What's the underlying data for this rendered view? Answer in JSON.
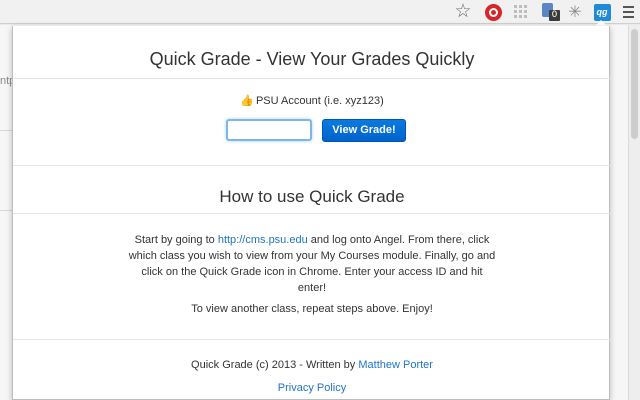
{
  "browser": {
    "icons": [
      "star-icon",
      "ublock-icon",
      "grid-icon",
      "extension-badge-icon",
      "bug-icon",
      "quick-grade-icon",
      "menu-icon"
    ],
    "extension_badge": "0",
    "quick_grade_icon_text": "qg"
  },
  "background_page": {
    "partial_text": "ntp"
  },
  "popup": {
    "title": "Quick Grade - View Your Grades Quickly",
    "account_label": "PSU Account (i.e. xyz123)",
    "input_value": "",
    "input_placeholder": "",
    "submit_label": "View Grade!",
    "howto_title": "How to use Quick Grade",
    "instructions_before_link": "Start by going to ",
    "instructions_link": "http://cms.psu.edu",
    "instructions_after_link": " and log onto Angel. From there, click which class you wish to view from your My Courses module. Finally, go and click on the Quick Grade icon in Chrome. Enter your access ID and hit enter!",
    "repeat_note": "To view another class, repeat steps above. Enjoy!",
    "footer_prefix": "Quick Grade (c) 2013 - Written by ",
    "footer_author": "Matthew Porter",
    "privacy_label": "Privacy Policy"
  },
  "colors": {
    "accent": "#0a6fd6",
    "link": "#1f73c9"
  }
}
